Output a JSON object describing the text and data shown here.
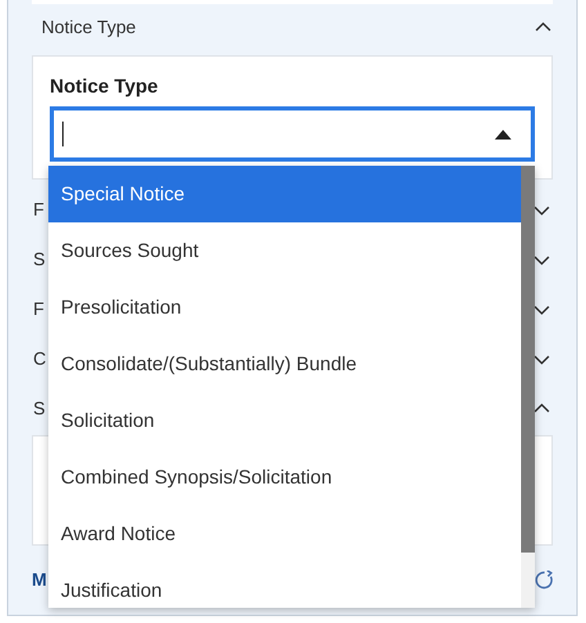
{
  "filter_section": {
    "title": "Notice Type",
    "expanded": true
  },
  "notice_type_field": {
    "label": "Notice Type",
    "open": true
  },
  "options": [
    {
      "label": "Special Notice",
      "selected": true
    },
    {
      "label": "Sources Sought",
      "selected": false
    },
    {
      "label": "Presolicitation",
      "selected": false
    },
    {
      "label": "Consolidate/(Substantially) Bundle",
      "selected": false
    },
    {
      "label": "Solicitation",
      "selected": false
    },
    {
      "label": "Combined Synopsis/Solicitation",
      "selected": false
    },
    {
      "label": "Award Notice",
      "selected": false
    },
    {
      "label": "Justification",
      "selected": false
    }
  ],
  "other_sections": [
    {
      "label": "F",
      "expanded": false
    },
    {
      "label": "S",
      "expanded": false
    },
    {
      "label": "F",
      "expanded": false
    },
    {
      "label": "C",
      "expanded": false
    },
    {
      "label": "S",
      "expanded": true
    }
  ],
  "footer_link": "M"
}
